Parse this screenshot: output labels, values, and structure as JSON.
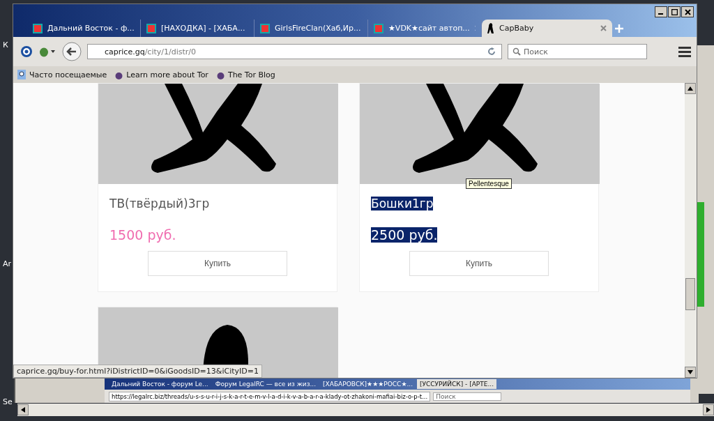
{
  "desktop": {
    "edge_labels": [
      "К",
      "Ar",
      "Se"
    ]
  },
  "browser": {
    "tabs": [
      {
        "title": "Дальний Восток - ф...",
        "selected": false
      },
      {
        "title": "[НАХОДКА] - [ХАБА...",
        "selected": false
      },
      {
        "title": "GirlsFireClan(Хаб,Ир...",
        "selected": false
      },
      {
        "title": "★VDK★сайт автоп...",
        "selected": false
      },
      {
        "title": "CapBaby",
        "selected": true
      }
    ],
    "address": {
      "host": "caprice.gq",
      "path": "/city/1/distr/0"
    },
    "search": {
      "placeholder": "Поиск"
    },
    "bookmarks": [
      "Часто посещаемые",
      "Learn more about Tor",
      "The Tor Blog"
    ]
  },
  "cards": [
    {
      "kind": "product",
      "name": "ТВ(твёрдый)3гр",
      "price": "1500 руб.",
      "button": "Купить",
      "selected": false
    },
    {
      "kind": "product",
      "name": "Бошки1гр",
      "price": "2500 руб.",
      "button": "Купить",
      "selected": true
    },
    {
      "kind": "picture"
    }
  ],
  "tooltip": "Pellentesque",
  "status_link": "caprice.gq/buy-for.html?iDistrictID=0&iGoodsID=13&iCityID=1",
  "background_window": {
    "tabs": [
      {
        "title": "Дальний Восток - форум Le...",
        "selected": false
      },
      {
        "title": "Форум LegalRC — все из жиз...",
        "selected": false
      },
      {
        "title": "[ХАБАРОВСК]★★★РОСС★...",
        "selected": false
      },
      {
        "title": "[УССУРИЙСК] - [АРТЕ...",
        "selected": true
      }
    ],
    "url": "https://legalrc.biz/threads/u-s-s-u-r-i-j-s-k-a-r-t-e-m-v-l-a-d-i-k-v-a-b-a-r-a-klady-ot-zhakoni-mafiai-biz-o-p-t...",
    "search_placeholder": "Поиск"
  }
}
